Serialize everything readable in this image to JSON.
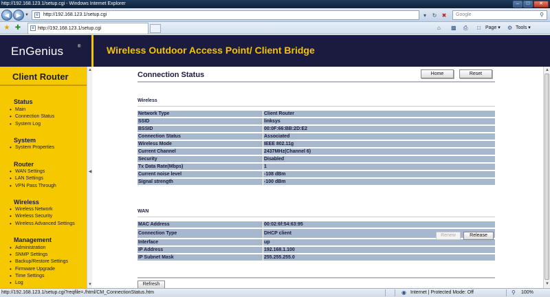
{
  "window": {
    "title": "http://192.168.123.1/setup.cgi - Windows Internet Explorer",
    "controls": [
      "–",
      "□",
      "✕"
    ]
  },
  "addressbar": {
    "url": "http://192.168.123.1/setup.cgi",
    "search_placeholder": "Google"
  },
  "tabs": [
    {
      "label": "http://192.168.123.1/setup.cgi"
    }
  ],
  "commandbar": {
    "page_label": "Page",
    "tools_label": "Tools"
  },
  "header": {
    "logo": "EnGenius",
    "logo_mark": "®",
    "product_title": "Wireless Outdoor Access Point/ Client Bridge"
  },
  "sidebar": {
    "title": "Client Router",
    "sections": [
      {
        "heading": "Status",
        "items": [
          "Main",
          "Connection Status",
          "System Log"
        ]
      },
      {
        "heading": "System",
        "items": [
          "System Properties"
        ]
      },
      {
        "heading": "Router",
        "items": [
          "WAN Settings",
          "LAN Settings",
          "VPN Pass Through"
        ]
      },
      {
        "heading": "Wireless",
        "items": [
          "Wireless Network",
          "Wireless Security",
          "Wireless Advanced Settings"
        ]
      },
      {
        "heading": "Management",
        "items": [
          "Administration",
          "SNMP Settings",
          "Backup/Restore Settings",
          "Firmware Upgrade",
          "Time Settings",
          "Log"
        ]
      }
    ]
  },
  "content": {
    "title": "Connection Status",
    "home_label": "Home",
    "reset_label": "Reset",
    "wireless_label": "Wireless",
    "wireless_rows": [
      {
        "k": "Network Type",
        "v": "Client Router"
      },
      {
        "k": "SSID",
        "v": "linksys"
      },
      {
        "k": "BSSID",
        "v": "00:0F:66:BB:2D:E2"
      },
      {
        "k": "Connection Status",
        "v": "Associated"
      },
      {
        "k": "Wireless Mode",
        "v": "IEEE 802.11g"
      },
      {
        "k": "Current Channel",
        "v": "2437MHz(Channel 6)"
      },
      {
        "k": "Security",
        "v": "Disabled"
      },
      {
        "k": "Tx Data Rate(Mbps)",
        "v": "1"
      },
      {
        "k": "Current noise level",
        "v": "-108 dBm"
      },
      {
        "k": "Signal strength",
        "v": "-100 dBm"
      }
    ],
    "wan_label": "WAN",
    "wan_rows": [
      {
        "k": "MAC Address",
        "v": "00:02:6f:54:63:95"
      },
      {
        "k": "Connection Type",
        "v": "DHCP client"
      },
      {
        "k": "Interface",
        "v": "up"
      },
      {
        "k": "IP Address",
        "v": "192.168.1.100"
      },
      {
        "k": "IP Subnet Mask",
        "v": "255.255.255.0"
      }
    ],
    "renew_label": "Renew",
    "release_label": "Release",
    "refresh_label": "Refresh"
  },
  "statusbar": {
    "text": "http://192.168.123.1/setup.cgi?reqfile=./html/CM_ConnectionStatus.htm",
    "zone": "Internet | Protected Mode: Off",
    "zoom": "100%"
  },
  "colors": {
    "header_bg": "#1b1b3f",
    "accent_yellow": "#f5c400",
    "table_cell": "#a8b8cc"
  }
}
